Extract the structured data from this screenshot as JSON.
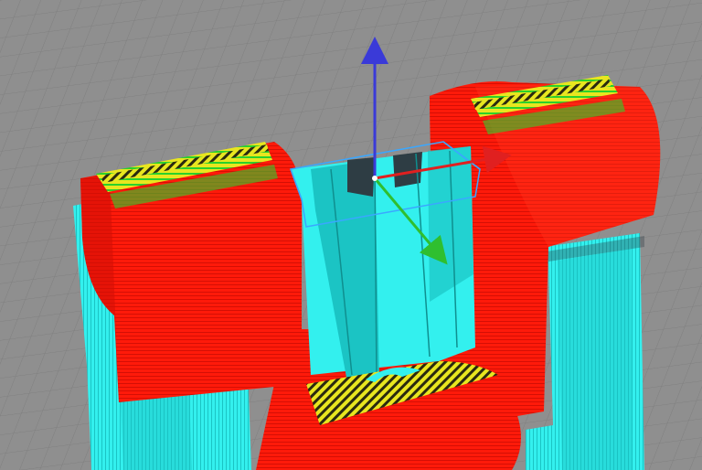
{
  "viewport": {
    "type": "3d-slicer-preview",
    "background_color": "#8f8f8f",
    "grid_color": "#7a7a7a",
    "colors": {
      "perimeter": "#ff1a0a",
      "perimeter_shade": "#d40f05",
      "inner_wall": "#33f0ee",
      "inner_wall_shade": "#1bc4c4",
      "top_infill": "#e8e61f",
      "infill_green": "#2bd12b",
      "support_dark": "#2e3d44",
      "bbox": "#3aa7ff",
      "axis_x": "#e02020",
      "axis_y": "#2fbf2f",
      "axis_z": "#3a3ad8"
    },
    "gizmo": {
      "axes": [
        "x-axis-arrow",
        "y-axis-arrow",
        "z-axis-arrow"
      ]
    }
  }
}
